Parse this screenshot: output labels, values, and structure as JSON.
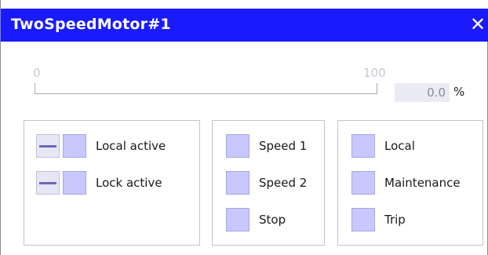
{
  "window": {
    "title": "TwoSpeedMotor#1",
    "close_glyph": "✕"
  },
  "scale": {
    "min_label": "0",
    "max_label": "100",
    "value_text": "0.0",
    "unit": "%",
    "fill_percent": 0
  },
  "local_group": {
    "items": [
      {
        "label": "Local active",
        "state_icon": "dash-icon"
      },
      {
        "label": "Lock active",
        "state_icon": "dash-icon"
      }
    ]
  },
  "speed_group": {
    "items": [
      {
        "label": "Speed 1"
      },
      {
        "label": "Speed 2"
      },
      {
        "label": "Stop"
      }
    ]
  },
  "mode_group": {
    "items": [
      {
        "label": "Local"
      },
      {
        "label": "Maintenance"
      },
      {
        "label": "Trip"
      }
    ]
  },
  "colors": {
    "titlebar": "#1a1aff",
    "lamp_off": "#c8c8ff",
    "value_box": "#ebebf5"
  }
}
